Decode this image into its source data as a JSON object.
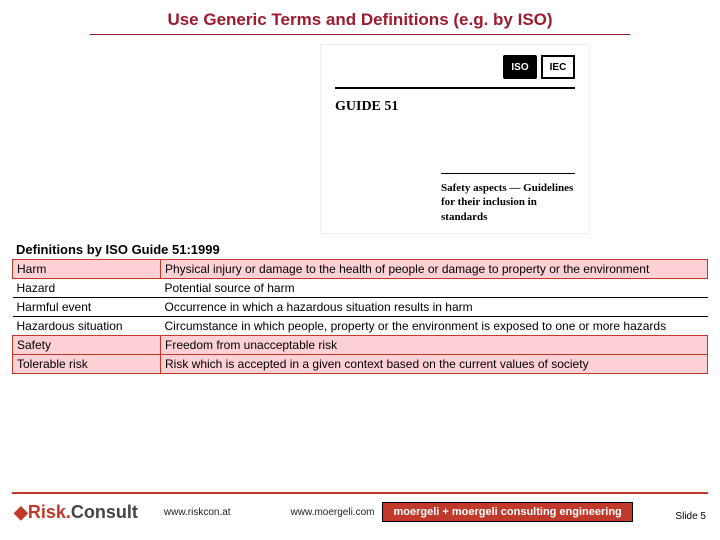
{
  "title": "Use Generic Terms and Definitions (e.g. by ISO)",
  "doc": {
    "iso": "ISO",
    "iec": "IEC",
    "guide": "GUIDE 51",
    "subtitle": "Safety aspects — Guidelines for their inclusion in standards"
  },
  "table_heading": "Definitions by ISO Guide 51:1999",
  "rows": [
    {
      "term": "Harm",
      "def": "Physical injury or damage to the health of people or damage to property or the environment",
      "hl": true
    },
    {
      "term": "Hazard",
      "def": "Potential source of harm",
      "hl": false
    },
    {
      "term": "Harmful event",
      "def": "Occurrence in which a hazardous situation results in harm",
      "hl": false
    },
    {
      "term": "Hazardous situation",
      "def": "Circumstance in which people, property or the environment is exposed to one or more hazards",
      "hl": false
    },
    {
      "term": "Safety",
      "def": "Freedom from unacceptable risk",
      "hl": true
    },
    {
      "term": "Tolerable risk",
      "def": "Risk which is accepted in a given context based on the current values of society",
      "hl": true
    }
  ],
  "footer": {
    "logo1a": "Risk.",
    "logo1b": "Consult",
    "url1": "www.riskcon.at",
    "url2": "www.moergeli.com",
    "logo2": "moergeli + moergeli consulting engineering",
    "slide": "Slide 5"
  }
}
